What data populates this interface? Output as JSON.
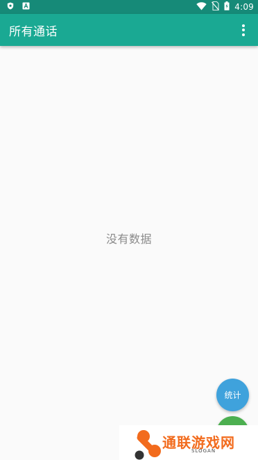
{
  "status_bar": {
    "time": "4:09",
    "icons": [
      "shield-icon",
      "a-icon",
      "wifi-icon",
      "no-sim-icon",
      "battery-charging-icon"
    ]
  },
  "toolbar": {
    "title": "所有通话",
    "background": "#1aa993",
    "menu_icon": "more-vert-icon"
  },
  "empty_state": {
    "message": "没有数据"
  },
  "fab_stats": {
    "label": "统计",
    "color": "#3fa2dc"
  },
  "fab_secondary": {
    "color": "#4caf50"
  },
  "watermark": {
    "text": "通联游戏网",
    "slogan": "SLOGAN",
    "color": "#f26b1d"
  }
}
